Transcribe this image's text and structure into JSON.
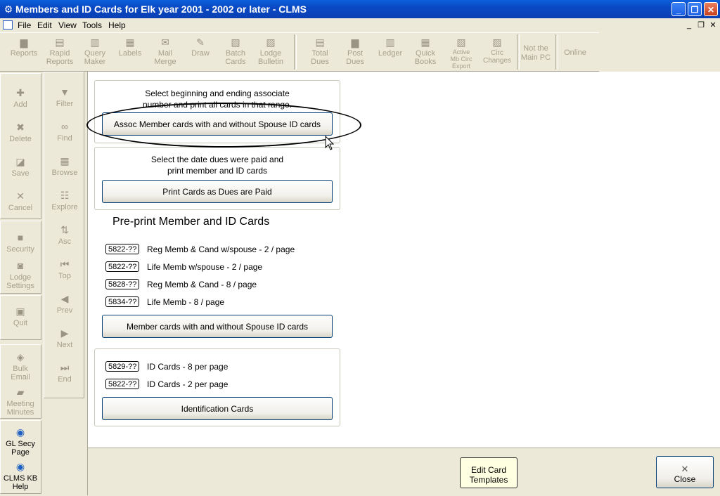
{
  "window": {
    "title": "Members and ID Cards for Elk year 2001 - 2002 or later - CLMS"
  },
  "menu": [
    "File",
    "Edit",
    "View",
    "Tools",
    "Help"
  ],
  "toolbar": [
    {
      "label": "Reports",
      "icon": "reports-icon"
    },
    {
      "label": "Rapid Reports",
      "l1": "Rapid",
      "l2": "Reports",
      "icon": "rapid-reports-icon"
    },
    {
      "label": "Query Maker",
      "l1": "Query",
      "l2": "Maker",
      "icon": "query-icon"
    },
    {
      "label": "Labels",
      "icon": "labels-icon"
    },
    {
      "label": "Mail Merge",
      "l1": "Mail",
      "l2": "Merge",
      "icon": "mail-merge-icon"
    },
    {
      "label": "Draw",
      "icon": "draw-icon"
    },
    {
      "label": "Batch Cards",
      "l1": "Batch",
      "l2": "Cards",
      "icon": "batch-cards-icon"
    },
    {
      "label": "Lodge Bulletin",
      "l1": "Lodge",
      "l2": "Bulletin",
      "icon": "bulletin-icon"
    },
    {
      "label": "Total Dues",
      "l1": "Total",
      "l2": "Dues",
      "icon": "total-dues-icon"
    },
    {
      "label": "Post Dues",
      "l1": "Post",
      "l2": "Dues",
      "icon": "post-dues-icon"
    },
    {
      "label": "Ledger",
      "icon": "ledger-icon"
    },
    {
      "label": "Quick Books",
      "l1": "Quick",
      "l2": "Books",
      "icon": "quickbooks-icon"
    },
    {
      "label": "Active Mb Circ Export",
      "l1": "Active",
      "l2": "Mb Circ",
      "l3": "Export",
      "icon": "export-icon"
    },
    {
      "label": "Circ Changes",
      "l1": "Circ",
      "l2": "Changes",
      "icon": "circ-changes-icon"
    },
    {
      "label": "Not the Main PC",
      "l1": "Not the",
      "l2": "Main PC"
    },
    {
      "label": "Online"
    }
  ],
  "sidebar_left": {
    "add": "Add",
    "delete": "Delete",
    "save": "Save",
    "cancel": "Cancel",
    "security": "Security",
    "lodge_settings_1": "Lodge",
    "lodge_settings_2": "Settings",
    "quit": "Quit",
    "bulk_email_1": "Bulk",
    "bulk_email_2": "Email",
    "meeting_minutes_1": "Meeting",
    "meeting_minutes_2": "Minutes",
    "gl_secy_1": "GL Secy",
    "gl_secy_2": "Page",
    "clms_kb_1": "CLMS KB",
    "clms_kb_2": "Help"
  },
  "sidebar_nav": {
    "filter": "Filter",
    "find": "Find",
    "browse": "Browse",
    "explore": "Explore",
    "asc": "Asc",
    "top": "Top",
    "prev": "Prev",
    "next": "Next",
    "end": "End"
  },
  "panel1": {
    "line1": "Select beginning and ending associate",
    "line2": "number and print all cards in that range.",
    "button": "Assoc Member cards with and without Spouse ID cards"
  },
  "panel2": {
    "line1": "Select the date dues were paid and",
    "line2": "print member and ID cards",
    "button": "Print Cards as Dues are Paid"
  },
  "preprint": {
    "title": "Pre-print Member and ID Cards",
    "rows": [
      {
        "tag": "5822-??",
        "text": "Reg Memb & Cand w/spouse - 2 / page"
      },
      {
        "tag": "5822-??",
        "text": "Life Memb w/spouse - 2 / page"
      },
      {
        "tag": "5828-??",
        "text": "Reg Memb & Cand - 8 / page"
      },
      {
        "tag": "5834-??",
        "text": "Life Memb  - 8 / page"
      }
    ],
    "button": "Member cards with and without Spouse ID cards"
  },
  "idcards": {
    "rows": [
      {
        "tag": "5829-??",
        "text": "ID Cards -   8 per page"
      },
      {
        "tag": "5822-??",
        "text": "ID Cards -   2 per page"
      }
    ],
    "button": "Identification Cards"
  },
  "bottom": {
    "edit_1": "Edit Card",
    "edit_2": "Templates",
    "close": "Close"
  }
}
